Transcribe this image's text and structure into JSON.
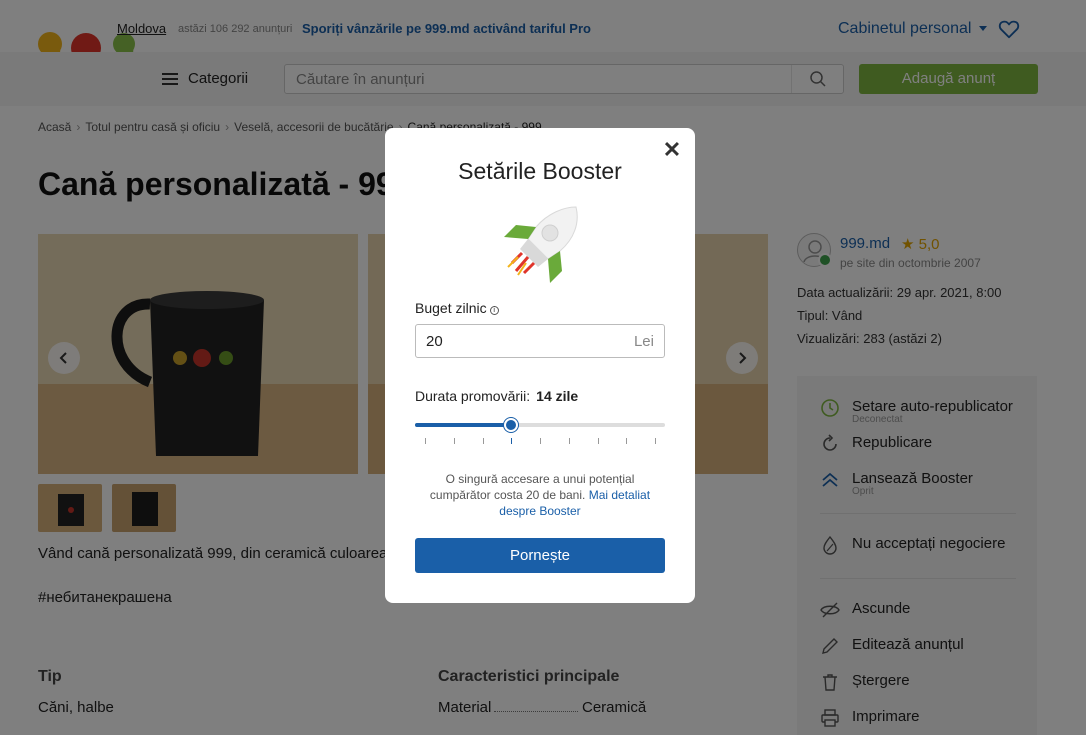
{
  "header": {
    "region": "Moldova",
    "today_count": "astăzi 106 292 anunțuri",
    "promo_text": "Sporiți vânzările pe 999.md activând tariful Pro",
    "cabinet_label": "Cabinetul personal",
    "categories_label": "Categorii",
    "search_placeholder": "Căutare în anunțuri",
    "add_button": "Adaugă anunț"
  },
  "breadcrumb": [
    "Acasă",
    "Totul pentru casă și oficiu",
    "Veselă, accesorii de bucătărie",
    "Cană personalizată - 999"
  ],
  "listing": {
    "title": "Cană personalizată - 999",
    "description": "Vând cană personalizată 999, din ceramică culoarea neagră.",
    "hashtag": "#небитанекрашена",
    "specs": {
      "type_heading": "Tip",
      "type_value": "Căni, halbe",
      "main_heading": "Caracteristici principale",
      "material_label": "Material",
      "material_value": "Ceramică"
    }
  },
  "seller": {
    "name": "999.md",
    "rating": "★ 5,0",
    "since": "pe site din octombrie 2007",
    "updated": "Data actualizării: 29 apr. 2021, 8:00",
    "type": "Tipul: Vând",
    "views": "Vizualizări: 283 (astăzi 2)"
  },
  "actions": {
    "auto_republish": "Setare auto-republicator",
    "auto_republish_status": "Deconectat",
    "republish": "Republicare",
    "booster": "Lansează Booster",
    "booster_status": "Oprit",
    "no_negotiation": "Nu acceptați negociere",
    "hide": "Ascunde",
    "edit": "Editează anunțul",
    "delete": "Ștergere",
    "print": "Imprimare"
  },
  "modal": {
    "title": "Setările Booster",
    "budget_label": "Buget zilnic",
    "budget_value": "20",
    "currency": "Lei",
    "duration_label": "Durata promovării:",
    "duration_value": "14 zile",
    "slider_fraction": 0.385,
    "slider_ticks": 9,
    "slider_active_tick": 3,
    "note": "O singură accesare a unui potențial cumpărător costa 20 de bani.",
    "more_link": "Mai detaliat despre Booster",
    "start_button": "Pornește"
  },
  "colors": {
    "brand_blue": "#1a5fa8",
    "brand_green": "#7fb741",
    "logo_yellow": "#f3b41b",
    "logo_red": "#e0352b",
    "logo_green": "#8bc34a"
  }
}
